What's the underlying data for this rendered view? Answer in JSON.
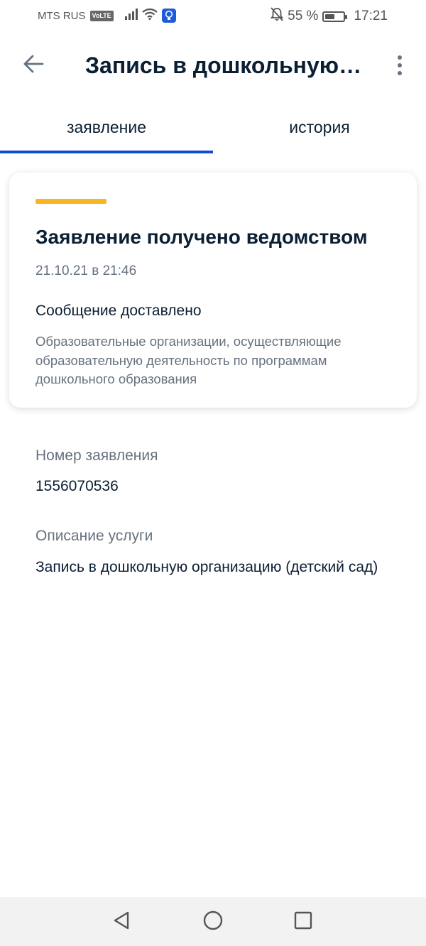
{
  "status_bar": {
    "carrier": "MTS RUS",
    "volte": "VoLTE",
    "battery_percent": "55 %",
    "battery_level": 0.55,
    "time": "17:21",
    "icons": [
      "signal-icon",
      "wifi-icon",
      "lightbulb-icon",
      "mute-bell-icon",
      "battery-icon"
    ]
  },
  "app_bar": {
    "title": "Запись в дошкольную организацию (детский сад)",
    "back_icon": "arrow-left-icon",
    "more_icon": "more-vertical-icon"
  },
  "tabs": [
    {
      "label": "заявление",
      "active": true
    },
    {
      "label": "история",
      "active": false
    }
  ],
  "status_card": {
    "accent_color": "#f6b521",
    "title": "Заявление получено ведомством",
    "date": "21.10.21 в 21:46",
    "message": "Сообщение доставлено",
    "organization": "Образовательные организации, осуществляющие образовательную деятельность по программам дошкольного образования"
  },
  "details": {
    "number_label": "Номер заявления",
    "number_value": "1556070536",
    "service_label": "Описание услуги",
    "service_value": "Запись в дошкольную организацию (детский сад)"
  },
  "nav_bar": {
    "icons": [
      "back-triangle-icon",
      "home-circle-icon",
      "recents-square-icon"
    ]
  },
  "colors": {
    "primary": "#0d4cd3",
    "text": "#0b1f33",
    "secondary_text": "#66727f",
    "accent": "#f6b521"
  }
}
